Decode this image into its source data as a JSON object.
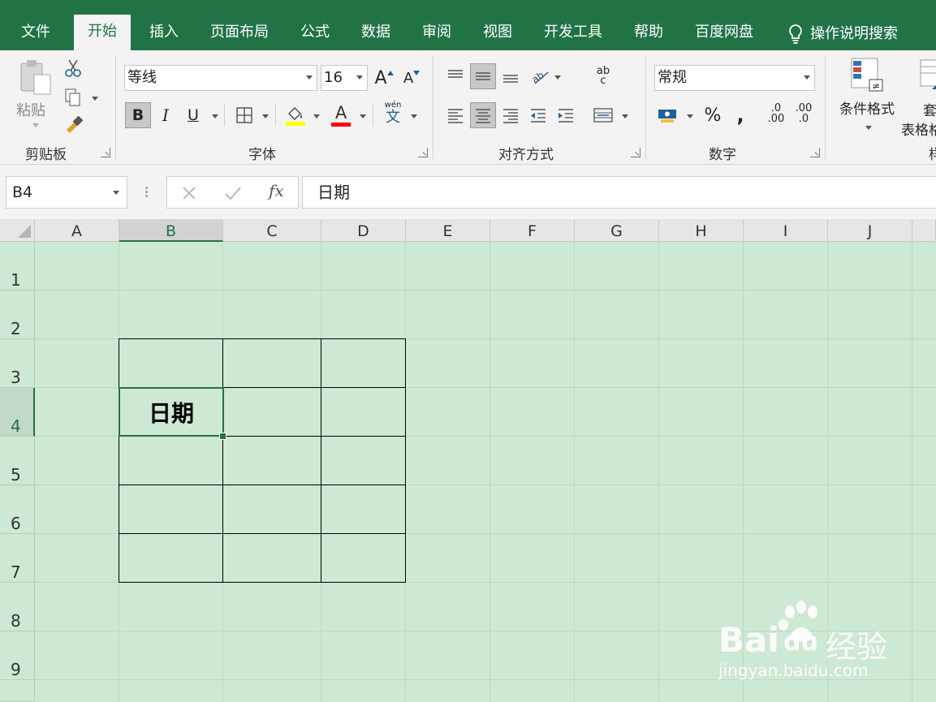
{
  "menu": {
    "tabs": [
      "文件",
      "开始",
      "插入",
      "页面布局",
      "公式",
      "数据",
      "审阅",
      "视图",
      "开发工具",
      "帮助",
      "百度网盘"
    ],
    "active": "开始",
    "search": "操作说明搜索"
  },
  "ribbon": {
    "clipboard": {
      "paste": "粘贴",
      "label": "剪贴板"
    },
    "font": {
      "name": "等线",
      "size": "16",
      "bold": "B",
      "italic": "I",
      "underline": "U",
      "grow": "A",
      "shrink": "A",
      "font_color_letter": "A",
      "phonetic_top": "wén",
      "phonetic_char": "文",
      "label": "字体"
    },
    "alignment": {
      "wrap_top": "ab",
      "wrap_bottom": "c",
      "label": "对齐方式"
    },
    "number": {
      "format": "常规",
      "percent": "%",
      "comma": ",",
      "dec_inc_top": ".0",
      "dec_inc_bottom": ".00",
      "dec_dec_top": ".00",
      "dec_dec_bottom": ".0",
      "label": "数字"
    },
    "styles": {
      "conditional": "条件格式",
      "table_top": "套",
      "table_bottom": "表格格",
      "label": "样"
    }
  },
  "formula_bar": {
    "name_box": "B4",
    "fx": "fx",
    "content": "日期"
  },
  "grid": {
    "columns": [
      "A",
      "B",
      "C",
      "D",
      "E",
      "F",
      "G",
      "H",
      "I",
      "J"
    ],
    "rows": [
      "1",
      "2",
      "3",
      "4",
      "5",
      "6",
      "7",
      "8",
      "9"
    ],
    "selected_column": "B",
    "selected_row": "4",
    "active_cell_value": "日期"
  },
  "watermark": {
    "brand_left": "Bai",
    "brand_right": "du",
    "brand_cn": "经验",
    "url": "jingyan.baidu.com"
  },
  "colors": {
    "accent": "#217346",
    "sheet_bg": "#cde8d3",
    "highlight": "#ffff00",
    "font_red": "#ff0000"
  }
}
